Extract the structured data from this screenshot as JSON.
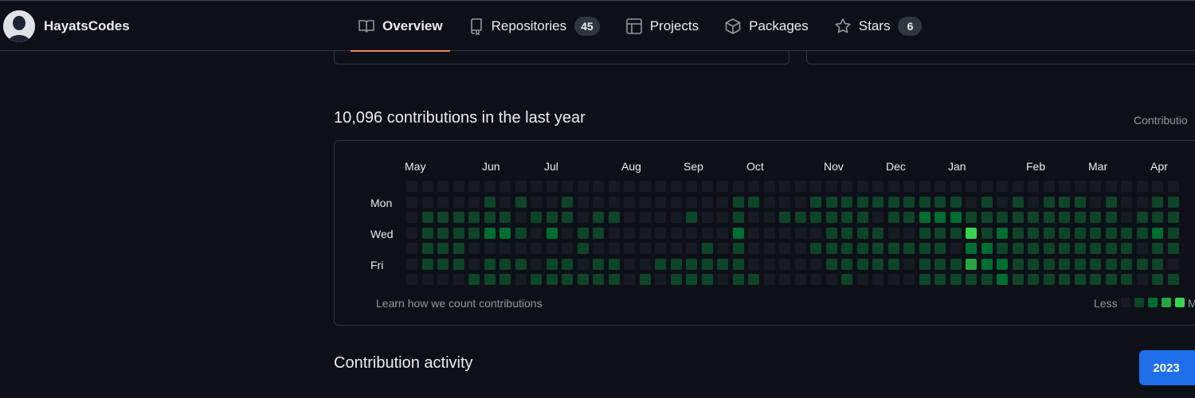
{
  "profile": {
    "username": "HayatsCodes"
  },
  "tabs": [
    {
      "label": "Overview"
    },
    {
      "label": "Repositories",
      "count": "45"
    },
    {
      "label": "Projects"
    },
    {
      "label": "Packages"
    },
    {
      "label": "Stars",
      "count": "6"
    }
  ],
  "contributions": {
    "title": "10,096 contributions in the last year",
    "settings_label": "Contributio",
    "months": [
      "May",
      "Jun",
      "Jul",
      "Aug",
      "Sep",
      "Oct",
      "Nov",
      "Dec",
      "Jan",
      "Feb",
      "Mar",
      "Apr"
    ],
    "weekday_labels": [
      "Mon",
      "Wed",
      "Fri"
    ],
    "learn_link": "Learn how we count contributions",
    "legend_less": "Less",
    "legend_more": "M",
    "levels": [
      "0000000000000000000000000000000000000000000000000000",
      "0000010100100000000001100011111111110101011101001100",
      "0111111011101100001001001111110112221111111111011111",
      "0111122102011000000002000001111001114121111111112121",
      "0111000000010000000101000011111111102211111111101111",
      "0111011101101100111111000001111101113221111111111011",
      "0000111011111101011101100000100001111121111111101111"
    ]
  },
  "activity": {
    "title": "Contribution activity",
    "year": "2023"
  },
  "colors": {
    "background": "#0d1117",
    "border": "#30363d",
    "text_muted": "#9198a1",
    "accent_underline": "#f78166",
    "primary_button": "#1f6feb",
    "heat_levels": [
      "#161b22",
      "#0e4429",
      "#006d32",
      "#26a641",
      "#39d353"
    ]
  },
  "icons": {
    "overview": "book-icon",
    "repositories": "repo-icon",
    "projects": "table-icon",
    "packages": "package-icon",
    "stars": "star-icon"
  }
}
